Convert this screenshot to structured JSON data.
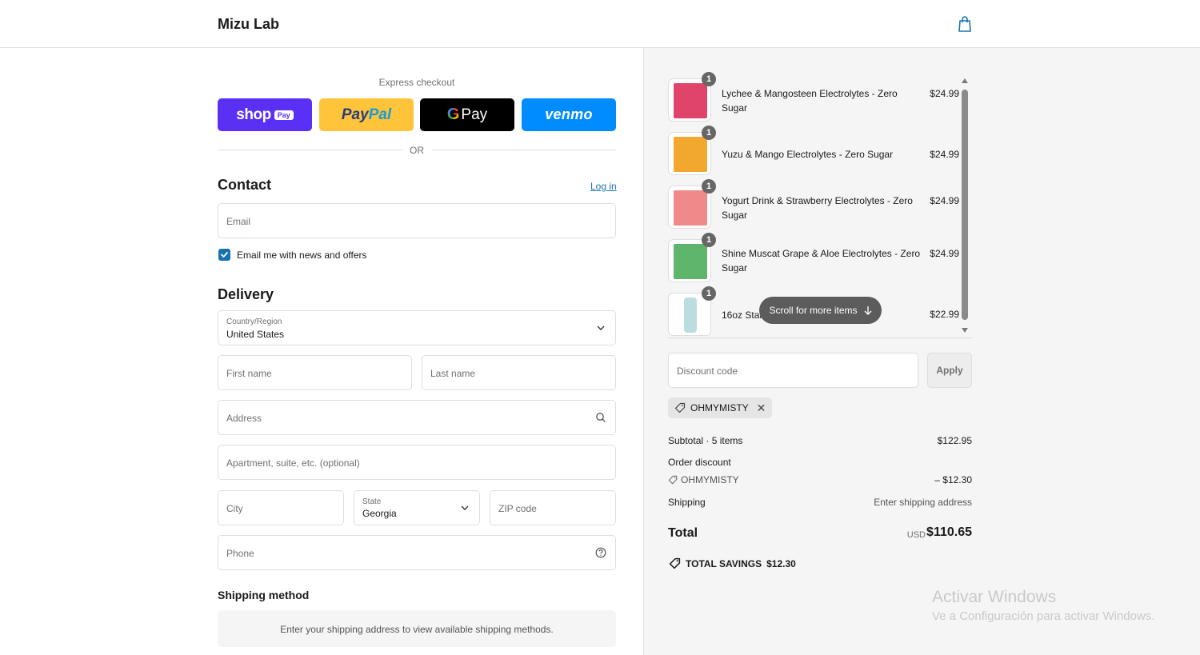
{
  "header": {
    "brand": "Mizu Lab",
    "cart_icon": "shopping-bag-icon"
  },
  "express": {
    "label": "Express checkout",
    "buttons": [
      {
        "name": "Shop Pay",
        "word": "shop",
        "chip": "Pay",
        "color": "#5a31f4"
      },
      {
        "name": "PayPal",
        "word1": "Pay",
        "word2": "Pal",
        "color": "#ffc439"
      },
      {
        "name": "Google Pay",
        "g": "G",
        "word": "Pay",
        "color": "#000000"
      },
      {
        "name": "Venmo",
        "word": "venmo",
        "color": "#008cff"
      }
    ],
    "or": "OR"
  },
  "contact": {
    "title": "Contact",
    "login_link": "Log in",
    "email_placeholder": "Email",
    "newsletter_label": "Email me with news and offers",
    "newsletter_checked": true
  },
  "delivery": {
    "title": "Delivery",
    "country_label": "Country/Region",
    "country_value": "United States",
    "first_name_placeholder": "First name",
    "last_name_placeholder": "Last name",
    "address_placeholder": "Address",
    "apartment_placeholder": "Apartment, suite, etc. (optional)",
    "city_placeholder": "City",
    "state_label": "State",
    "state_value": "Georgia",
    "zip_placeholder": "ZIP code",
    "phone_placeholder": "Phone"
  },
  "shipping_method": {
    "title": "Shipping method",
    "message": "Enter your shipping address to view available shipping methods."
  },
  "cart": {
    "items": [
      {
        "qty": "1",
        "name_line1": "Lychee & Mangosteen Electrolytes - Zero",
        "name_line2": "Sugar",
        "price": "$24.99",
        "color": "#e0446a"
      },
      {
        "qty": "1",
        "name_line1": "Yuzu & Mango Electrolytes - Zero Sugar",
        "name_line2": "",
        "price": "$24.99",
        "color": "#f2a72e"
      },
      {
        "qty": "1",
        "name_line1": "Yogurt Drink & Strawberry Electrolytes - Zero",
        "name_line2": "Sugar",
        "price": "$24.99",
        "color": "#f08a8a"
      },
      {
        "qty": "1",
        "name_line1": "Shine Muscat Grape & Aloe Electrolytes - Zero",
        "name_line2": "Sugar",
        "price": "$24.99",
        "color": "#5fb56a"
      },
      {
        "qty": "1",
        "name_line1": "16oz Stai",
        "name_line2": "",
        "price": "$22.99",
        "color": "#bcdde0"
      }
    ],
    "scroll_hint": "Scroll for more items"
  },
  "discount": {
    "placeholder": "Discount code",
    "apply_label": "Apply",
    "applied_code": "OHMYMISTY"
  },
  "summary": {
    "subtotal_label": "Subtotal · 5 items",
    "subtotal_value": "$122.95",
    "order_discount_label": "Order discount",
    "discount_code": "OHMYMISTY",
    "discount_value": "– $12.30",
    "shipping_label": "Shipping",
    "shipping_value": "Enter shipping address",
    "total_label": "Total",
    "currency": "USD",
    "total_value": "$110.65",
    "savings_label": "TOTAL SAVINGS",
    "savings_value": "$12.30"
  },
  "watermark": {
    "title": "Activar Windows",
    "subtitle": "Ve a Configuración para activar Windows."
  }
}
